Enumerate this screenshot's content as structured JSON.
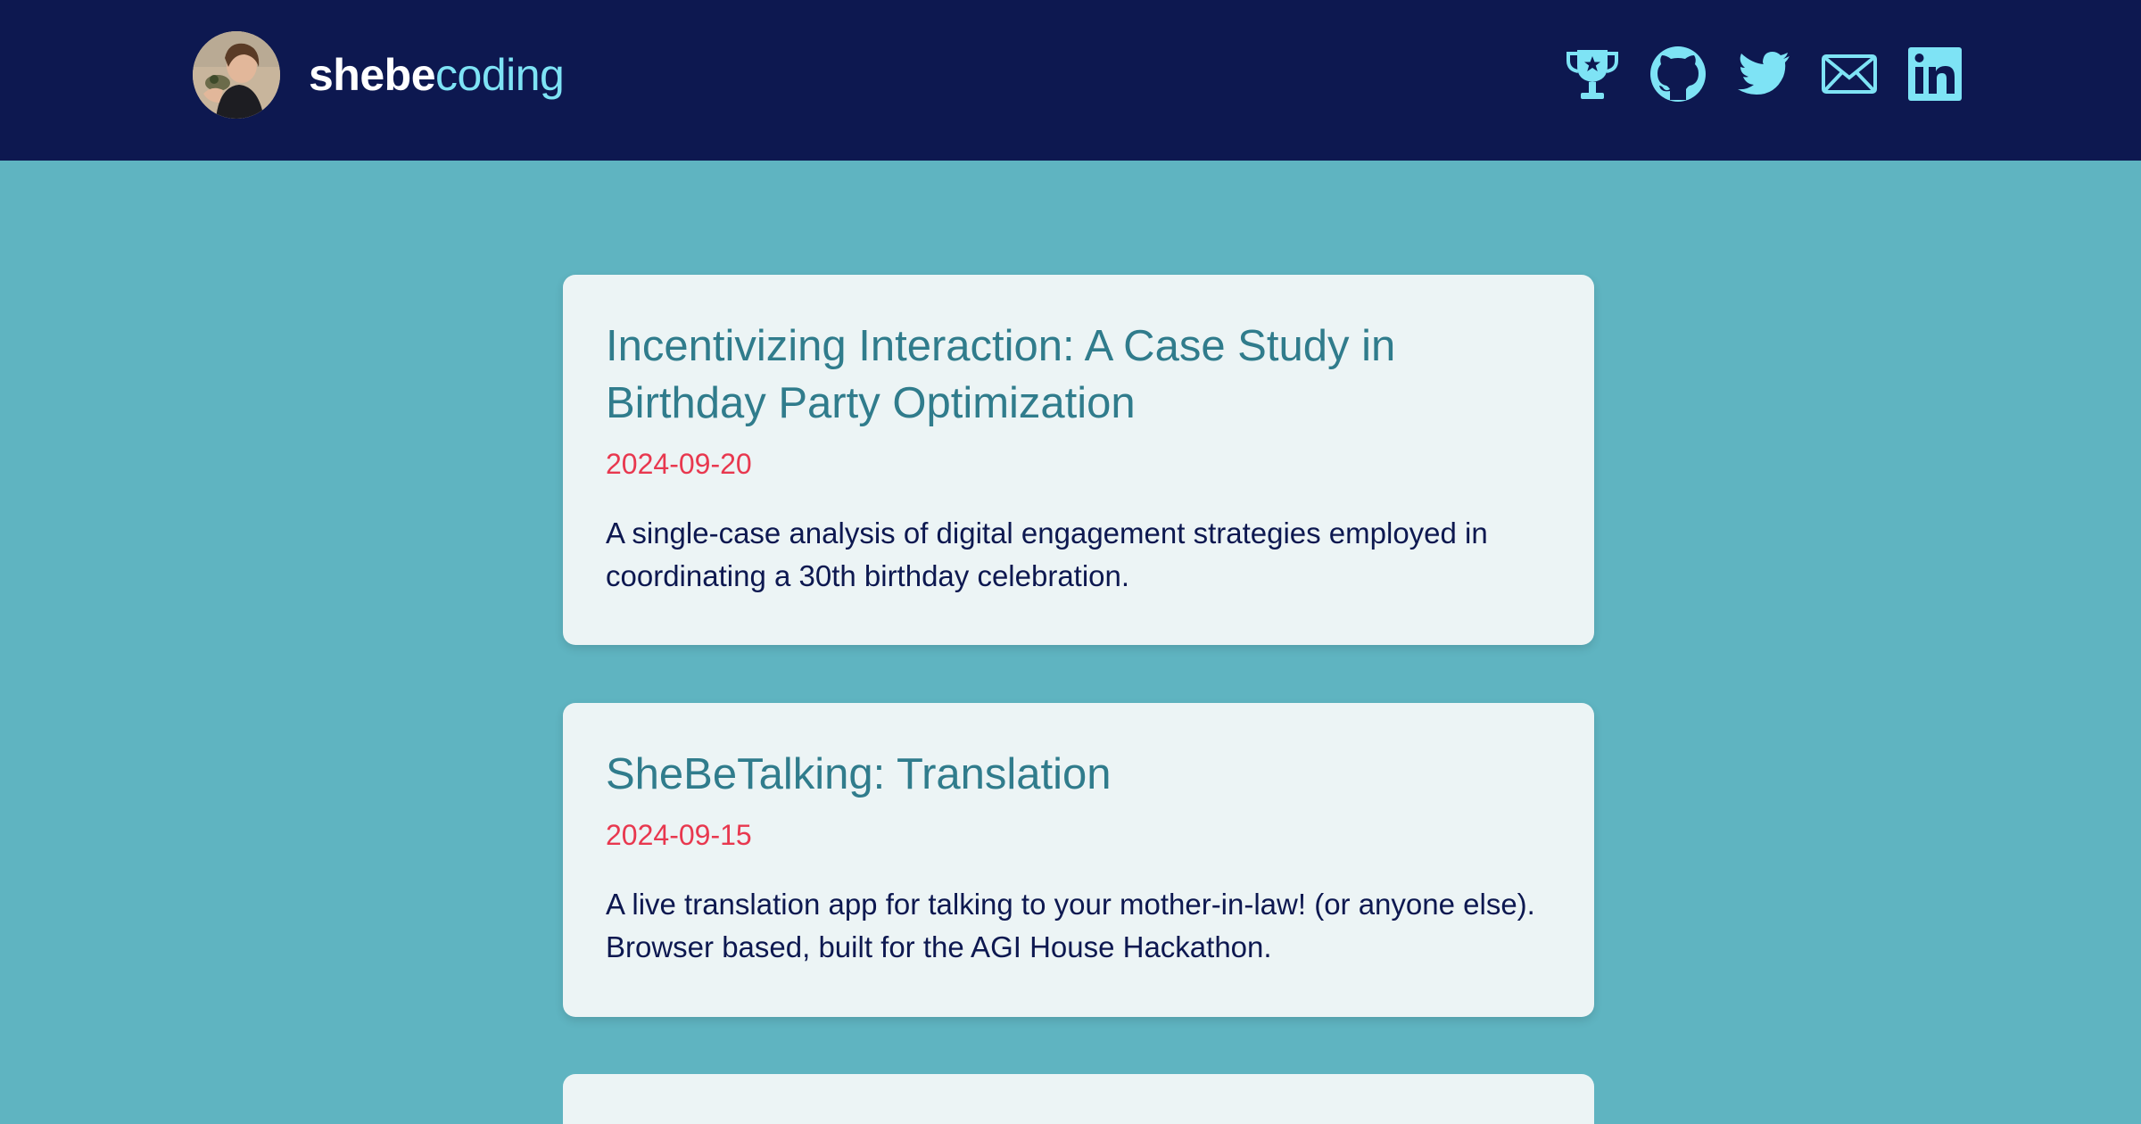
{
  "header": {
    "brand_bold": "shebe",
    "brand_light": "coding",
    "social_icons": [
      "trophy-icon",
      "github-icon",
      "twitter-icon",
      "mail-icon",
      "linkedin-icon"
    ]
  },
  "colors": {
    "header_bg": "#0d1850",
    "page_bg": "#5fb4c1",
    "accent": "#7ee3f5",
    "card_bg": "#ecf4f5",
    "title": "#307c8c",
    "date": "#e8384f",
    "text": "#0d1850"
  },
  "posts": [
    {
      "title": "Incentivizing Interaction: A Case Study in Birthday Party Optimization",
      "date": "2024-09-20",
      "description": "A single-case analysis of digital engagement strategies employed in coordinating a 30th birthday celebration."
    },
    {
      "title": "SheBeTalking: Translation",
      "date": "2024-09-15",
      "description": "A live translation app for talking to your mother-in-law! (or anyone else). Browser based, built for the AGI House Hackathon."
    },
    {
      "title": "",
      "date": "",
      "description": ""
    }
  ]
}
